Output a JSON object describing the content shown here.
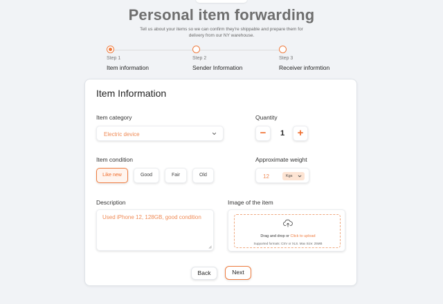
{
  "header": {
    "title": "Personal item forwarding",
    "subtitle": "Tell us about your items so we can confirm they're shippable and prepare them for delivery from our NY warehouse."
  },
  "steps": [
    {
      "number": "Step 1",
      "label": "Item information",
      "active": true
    },
    {
      "number": "Step 2",
      "label": "Sender Information",
      "active": false
    },
    {
      "number": "Step 3",
      "label": "Receiver informtion",
      "active": false
    }
  ],
  "form": {
    "title": "Item Information",
    "category": {
      "label": "Item category",
      "value": "Electric device",
      "icon": "chevron-down-icon"
    },
    "quantity": {
      "label": "Quantity",
      "value": "1",
      "minus": "−",
      "plus": "+"
    },
    "condition": {
      "label": "Item condition",
      "options": [
        "Like new",
        "Good",
        "Fair",
        "Old"
      ],
      "selected": "Like new"
    },
    "weight": {
      "label": "Approximate weight",
      "value": "12",
      "unit": "Kgs"
    },
    "description": {
      "label": "Description",
      "value": "Used iPhone 12, 128GB, good condition"
    },
    "image": {
      "label": "Image of the item",
      "drop_text": "Drag and drop or",
      "upload_link": "Click to upload",
      "formats": "Supported formats: CSV or XLS. Max Size: 25MB",
      "icon": "upload-cloud-icon"
    },
    "back_label": "Back",
    "next_label": "Next"
  },
  "colors": {
    "accent": "#ef7b3e",
    "background": "#f1f3f6"
  }
}
